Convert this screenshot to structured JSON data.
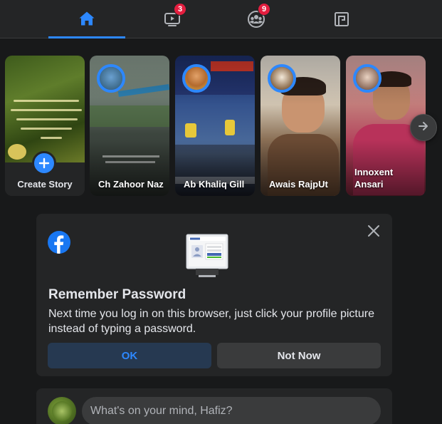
{
  "nav": {
    "tabs": [
      {
        "name": "home",
        "icon": "home-icon",
        "active": true,
        "badge": ""
      },
      {
        "name": "watch",
        "icon": "video-icon",
        "active": false,
        "badge": "3"
      },
      {
        "name": "groups",
        "icon": "groups-icon",
        "active": false,
        "badge": "9"
      },
      {
        "name": "gaming",
        "icon": "gaming-icon",
        "active": false,
        "badge": ""
      }
    ],
    "accent": "#2d88ff",
    "badge_color": "#e41e3f"
  },
  "stories": {
    "create_label": "Create Story",
    "items": [
      {
        "name": "Ch Zahoor Naz"
      },
      {
        "name": "Ab Khaliq Gill"
      },
      {
        "name": "Awais RajpUt"
      },
      {
        "name": "Innoxent Ansari"
      }
    ],
    "next_icon": "arrow-right-icon"
  },
  "remember_password": {
    "title": "Remember Password",
    "text": "Next time you log in on this browser, just click your profile picture instead of typing a password.",
    "ok_label": "OK",
    "not_now_label": "Not Now",
    "illustration_text": "facebook"
  },
  "composer": {
    "placeholder": "What's on your mind, Hafiz?"
  }
}
